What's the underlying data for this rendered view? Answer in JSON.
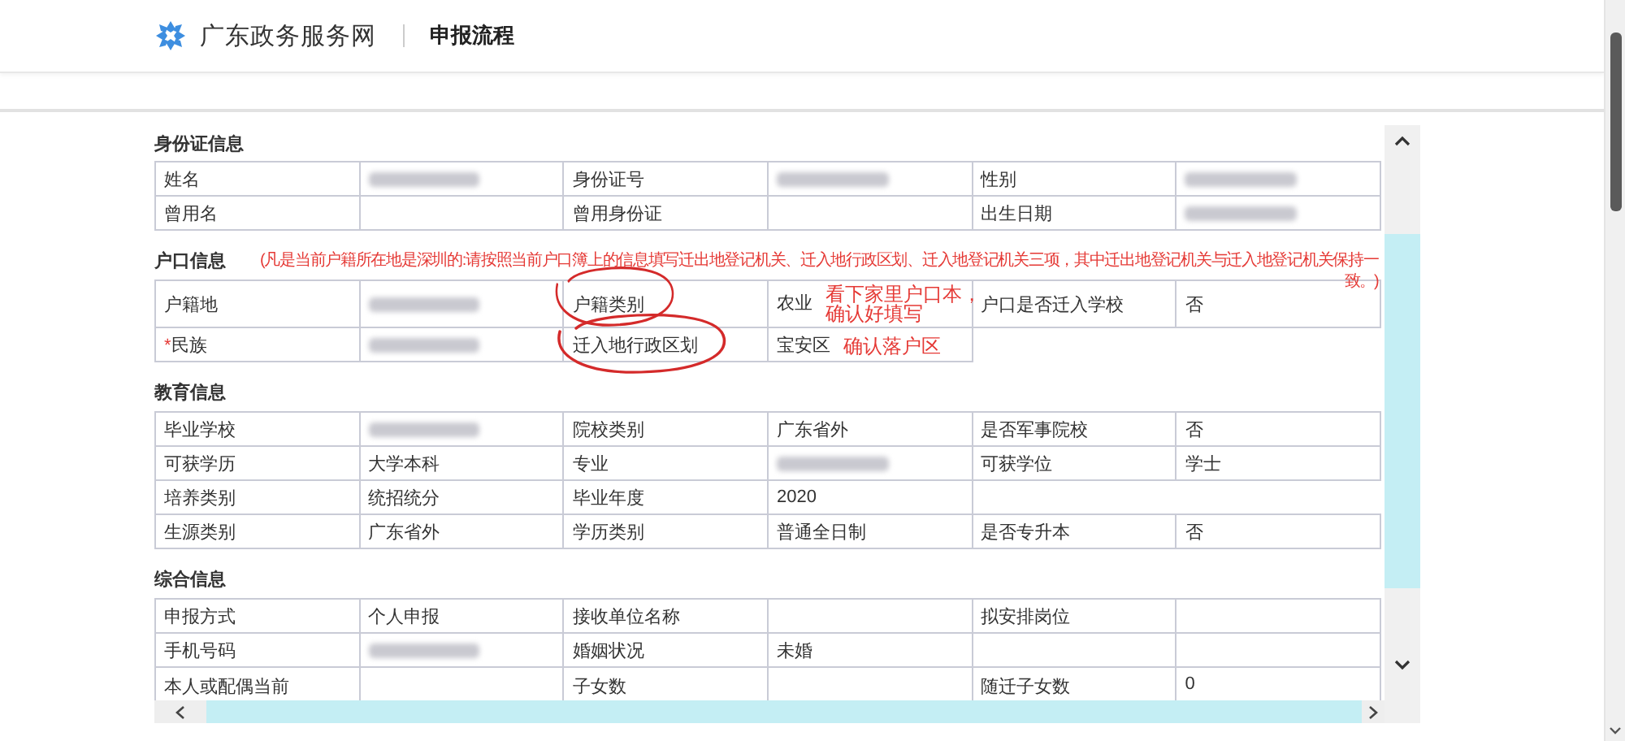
{
  "header": {
    "site_name": "广东政务服务网",
    "page_title": "申报流程"
  },
  "sections": [
    {
      "title": "身份证信息",
      "rows": [
        {
          "cells": [
            {
              "kind": "label",
              "text": "姓名",
              "circled": false
            },
            {
              "kind": "redacted"
            },
            {
              "kind": "label",
              "text": "身份证号",
              "circled": false
            },
            {
              "kind": "redacted"
            },
            {
              "kind": "label",
              "text": "性别",
              "circled": false
            },
            {
              "kind": "redacted"
            }
          ]
        },
        {
          "cells": [
            {
              "kind": "label",
              "text": "曾用名",
              "circled": false
            },
            {
              "kind": "empty"
            },
            {
              "kind": "label",
              "text": "曾用身份证",
              "circled": false
            },
            {
              "kind": "empty"
            },
            {
              "kind": "label",
              "text": "出生日期",
              "circled": false
            },
            {
              "kind": "redacted"
            }
          ]
        }
      ]
    },
    {
      "title": "户口信息",
      "note": "(凡是当前户籍所在地是深圳的:请按照当前户口簿上的信息填写迁出地登记机关、迁入地行政区划、迁入地登记机关三项，其中迁出地登记机关与迁入地登记机关保持一致。)",
      "rows": [
        {
          "tall": true,
          "cells": [
            {
              "kind": "label",
              "text": "户籍地",
              "circled": false
            },
            {
              "kind": "redacted"
            },
            {
              "kind": "label",
              "text": "户籍类别",
              "circled": true
            },
            {
              "kind": "value",
              "text": "农业",
              "annotation": "看下家里户口本，确认好填写"
            },
            {
              "kind": "label",
              "text": "户口是否迁入学校",
              "circled": false
            },
            {
              "kind": "value",
              "text": "否"
            }
          ]
        },
        {
          "cells": [
            {
              "kind": "label",
              "text": "民族",
              "required_mark": "*",
              "circled": false
            },
            {
              "kind": "redacted"
            },
            {
              "kind": "label",
              "text": "迁入地行政区划",
              "circled": true
            },
            {
              "kind": "value",
              "text": "宝安区",
              "annotation": "确认落户区"
            }
          ]
        }
      ]
    },
    {
      "title": "教育信息",
      "rows": [
        {
          "cells": [
            {
              "kind": "label",
              "text": "毕业学校",
              "circled": false
            },
            {
              "kind": "redacted"
            },
            {
              "kind": "label",
              "text": "院校类别",
              "circled": false
            },
            {
              "kind": "value",
              "text": "广东省外"
            },
            {
              "kind": "label",
              "text": "是否军事院校",
              "circled": false
            },
            {
              "kind": "value",
              "text": "否"
            }
          ]
        },
        {
          "cells": [
            {
              "kind": "label",
              "text": "可获学历",
              "circled": false
            },
            {
              "kind": "value",
              "text": "大学本科"
            },
            {
              "kind": "label",
              "text": "专业",
              "circled": false
            },
            {
              "kind": "redacted"
            },
            {
              "kind": "label",
              "text": "可获学位",
              "circled": false
            },
            {
              "kind": "value",
              "text": "学士"
            }
          ]
        },
        {
          "cells": [
            {
              "kind": "label",
              "text": "培养类别",
              "circled": false
            },
            {
              "kind": "value",
              "text": "统招统分"
            },
            {
              "kind": "label",
              "text": "毕业年度",
              "circled": false
            },
            {
              "kind": "value",
              "text": "2020"
            }
          ]
        },
        {
          "cells": [
            {
              "kind": "label",
              "text": "生源类别",
              "circled": false
            },
            {
              "kind": "value",
              "text": "广东省外"
            },
            {
              "kind": "label",
              "text": "学历类别",
              "circled": false
            },
            {
              "kind": "value",
              "text": "普通全日制"
            },
            {
              "kind": "label",
              "text": "是否专升本",
              "circled": false
            },
            {
              "kind": "value",
              "text": "否"
            }
          ]
        }
      ]
    },
    {
      "title": "综合信息",
      "rows": [
        {
          "cells": [
            {
              "kind": "label",
              "text": "申报方式",
              "circled": false
            },
            {
              "kind": "value",
              "text": "个人申报"
            },
            {
              "kind": "label",
              "text": "接收单位名称",
              "circled": false
            },
            {
              "kind": "empty"
            },
            {
              "kind": "label",
              "text": "拟安排岗位",
              "circled": false
            },
            {
              "kind": "empty"
            }
          ]
        },
        {
          "cells": [
            {
              "kind": "label",
              "text": "手机号码",
              "circled": false
            },
            {
              "kind": "redacted"
            },
            {
              "kind": "label",
              "text": "婚姻状况",
              "circled": false
            },
            {
              "kind": "value",
              "text": "未婚"
            },
            {
              "kind": "empty"
            },
            {
              "kind": "empty"
            }
          ]
        },
        {
          "tall": true,
          "cells": [
            {
              "kind": "label",
              "text": "本人或配偶当前",
              "circled": false
            },
            {
              "kind": "empty"
            },
            {
              "kind": "label",
              "text": "子女数",
              "circled": false
            },
            {
              "kind": "empty"
            },
            {
              "kind": "label",
              "text": "随迁子女数",
              "circled": false
            },
            {
              "kind": "value",
              "text": "0"
            }
          ]
        }
      ]
    }
  ]
}
